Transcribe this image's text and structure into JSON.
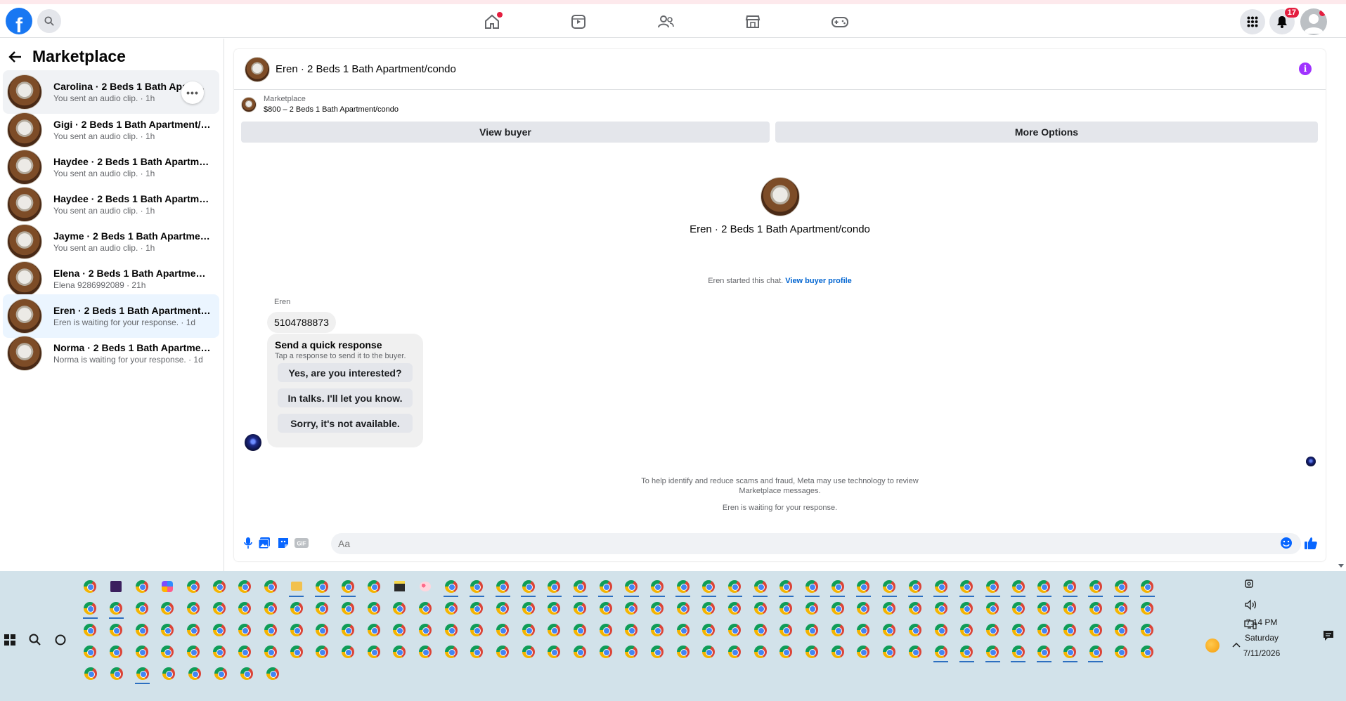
{
  "nav": {
    "notification_count": "17",
    "icons": [
      "home-icon",
      "video-icon",
      "friends-icon",
      "marketplace-icon",
      "gaming-icon"
    ]
  },
  "sidebar": {
    "title": "Marketplace",
    "conversations": [
      {
        "title": "Carolina · 2 Beds 1 Bath Apartment/condo",
        "subtitle": "You sent an audio clip. · 1h"
      },
      {
        "title": "Gigi · 2 Beds 1 Bath Apartment/co...",
        "subtitle": "You sent an audio clip. · 1h"
      },
      {
        "title": "Haydee · 2 Beds 1 Bath Apartment...",
        "subtitle": "You sent an audio clip. · 1h"
      },
      {
        "title": "Haydee · 2 Beds 1 Bath Apartment...",
        "subtitle": "You sent an audio clip. · 1h"
      },
      {
        "title": "Jayme · 2 Beds 1 Bath Apartment/c...",
        "subtitle": "You sent an audio clip. · 1h"
      },
      {
        "title": "Elena · 2 Beds 1 Bath Apartment/c...",
        "subtitle": "Elena 9286992089 · 21h"
      },
      {
        "title": "Eren · 2 Beds 1 Bath Apartment/co...",
        "subtitle": "Eren is waiting for your response. · 1d"
      },
      {
        "title": "Norma · 2 Beds 1 Bath Apartment/...",
        "subtitle": "Norma is waiting for your response. · 1d"
      }
    ]
  },
  "chat": {
    "header_title": "Eren · 2 Beds 1 Bath Apartment/condo",
    "marketplace_label": "Marketplace",
    "listing": "$800 – 2 Beds 1 Bath Apartment/condo",
    "view_buyer": "View buyer",
    "more_options": "More Options",
    "profile_title": "Eren · 2 Beds 1 Bath Apartment/condo",
    "started_text": "Eren started this chat.",
    "view_buyer_profile": "View buyer profile",
    "sender": "Eren",
    "message": "5104788873",
    "quick_title": "Send a quick response",
    "quick_sub": "Tap a response to send it to the buyer.",
    "quick_options": [
      "Yes, are you interested?",
      "In talks. I'll let you know.",
      "Sorry, it's not available."
    ],
    "disclaimer_line1": "To help identify and reduce scams and fraud, Meta may use technology to review",
    "disclaimer_line2": "Marketplace messages.",
    "waiting": "Eren is waiting for your response.",
    "input_placeholder": "Aa"
  },
  "taskbar": {
    "time": "7:14 PM",
    "day": "Saturday",
    "date": "7/11/2026"
  },
  "colors": {
    "facebook_blue": "#1877f2",
    "badge_red": "#e41e3f",
    "info_purple": "#a033ff",
    "link_blue": "#0064d1",
    "taskbar_bg": "#d2e2ea"
  }
}
